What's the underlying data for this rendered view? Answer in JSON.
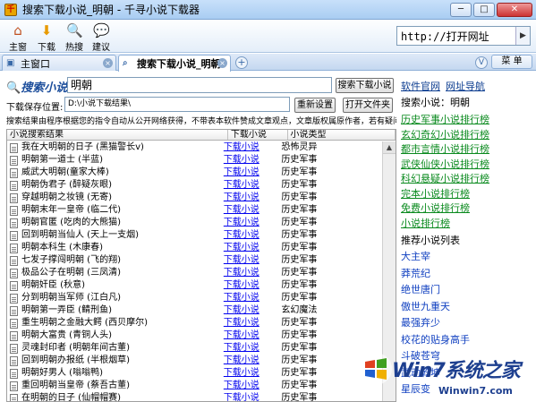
{
  "window": {
    "title": "搜索下载小说_明朝 - 千寻小说下载器",
    "app_icon_char": "千"
  },
  "toolbar": {
    "items": [
      {
        "label": "主窗",
        "icon": "home-icon"
      },
      {
        "label": "下载",
        "icon": "download-arrow-icon"
      },
      {
        "label": "热搜",
        "icon": "hot-search-icon"
      },
      {
        "label": "建议",
        "icon": "suggestion-icon"
      }
    ],
    "address": "http://打开网址"
  },
  "tabs": [
    {
      "label": "主窗口",
      "active": false
    },
    {
      "label": "搜索下载小说_明朝",
      "active": true
    }
  ],
  "tabbar": {
    "v_label": "V",
    "menu_label": "菜 单"
  },
  "search": {
    "logo": "搜索小说",
    "query": "明朝",
    "search_button": "搜索下载小说",
    "save_label": "下载保存位置:",
    "save_path": "D:\\小说下载结果\\",
    "reset_button": "重新设置",
    "open_button": "打开文件夹",
    "notice": "搜索结果由程序根据您的指令自动从公开网络获得，不带表本软件赞成文章观点，文章版权属原作者，若有疑问请"
  },
  "grid": {
    "headers": [
      "小说搜索结果",
      "下载小说",
      "小说类型"
    ],
    "rows": [
      {
        "title": "我在大明朝的日子 (黑猫警长v)",
        "link": "下载小说",
        "type": "恐怖灵异"
      },
      {
        "title": "明朝第一道士 (半蓝)",
        "link": "下载小说",
        "type": "历史军事"
      },
      {
        "title": "威武大明朝(童家大棒)",
        "link": "下载小说",
        "type": "历史军事"
      },
      {
        "title": "明朝伪君子 (醉疑灰眼)",
        "link": "下载小说",
        "type": "历史军事"
      },
      {
        "title": "穿越明朝之妆镜 (无寄)",
        "link": "下载小说",
        "type": "历史军事"
      },
      {
        "title": "明朝末年一皇帝 (临二代)",
        "link": "下载小说",
        "type": "历史军事"
      },
      {
        "title": "明朝官匿 (吃肉的大熊猫)",
        "link": "下载小说",
        "type": "历史军事"
      },
      {
        "title": "回到明朝当仙人 (天上一支烟)",
        "link": "下载小说",
        "type": "历史军事"
      },
      {
        "title": "明朝本科生 (木康春)",
        "link": "下载小说",
        "type": "历史军事"
      },
      {
        "title": "七发子撑闯明朝 (飞的翔)",
        "link": "下载小说",
        "type": "历史军事"
      },
      {
        "title": "极品公子在明朝 (三凤清)",
        "link": "下载小说",
        "type": "历史军事"
      },
      {
        "title": "明朝奸臣 (秋意)",
        "link": "下载小说",
        "type": "历史军事"
      },
      {
        "title": "分到明朝当军师 (江白凡)",
        "link": "下载小说",
        "type": "历史军事"
      },
      {
        "title": "明朝第一弄臣 (鲭刑鱼)",
        "link": "下载小说",
        "type": "玄幻魔法"
      },
      {
        "title": "重生明朝之金融大鳄 (西贝摩尔)",
        "link": "下载小说",
        "type": "历史军事"
      },
      {
        "title": "明朝大富贵 (青铜人头)",
        "link": "下载小说",
        "type": "历史军事"
      },
      {
        "title": "灵魂封印者 (明朝年间古董)",
        "link": "下载小说",
        "type": "历史军事"
      },
      {
        "title": "回到明朝办报纸 (半根烟草)",
        "link": "下载小说",
        "type": "历史军事"
      },
      {
        "title": "明朝好男人 (嗡嗡鸭)",
        "link": "下载小说",
        "type": "历史军事"
      },
      {
        "title": "重回明朝当皇帝 (蔡吾古董)",
        "link": "下载小说",
        "type": "历史军事"
      },
      {
        "title": "在明朝的日子 (仙帽帽赛)",
        "link": "下载小说",
        "type": "历史军事"
      }
    ]
  },
  "side": {
    "links": [
      "软件官网",
      "网址导航"
    ],
    "search_label": "搜索小说：明朝",
    "rankings": [
      "历史军事小说排行榜",
      "玄幻奇幻小说排行榜",
      "都市言情小说排行榜",
      "武侠仙侠小说排行榜",
      "科幻悬疑小说排行榜",
      "完本小说排行榜",
      "免费小说排行榜",
      "小说排行榜"
    ],
    "rec_title": "推荐小说列表",
    "recommended": [
      "大主宰",
      "莽荒纪",
      "绝世唐门",
      "傲世九重天",
      "最强弃少",
      "校花的贴身高手",
      "斗破苍穹",
      "武动乾坤",
      "星辰变"
    ]
  },
  "watermark": {
    "brand": "Win7系统之家",
    "url": "Winwin7.com"
  },
  "colors": {
    "ranking": "#0a8a1e",
    "recommend": "#1040c0",
    "link": "#0000ee",
    "logo": "#1e4f9c"
  }
}
